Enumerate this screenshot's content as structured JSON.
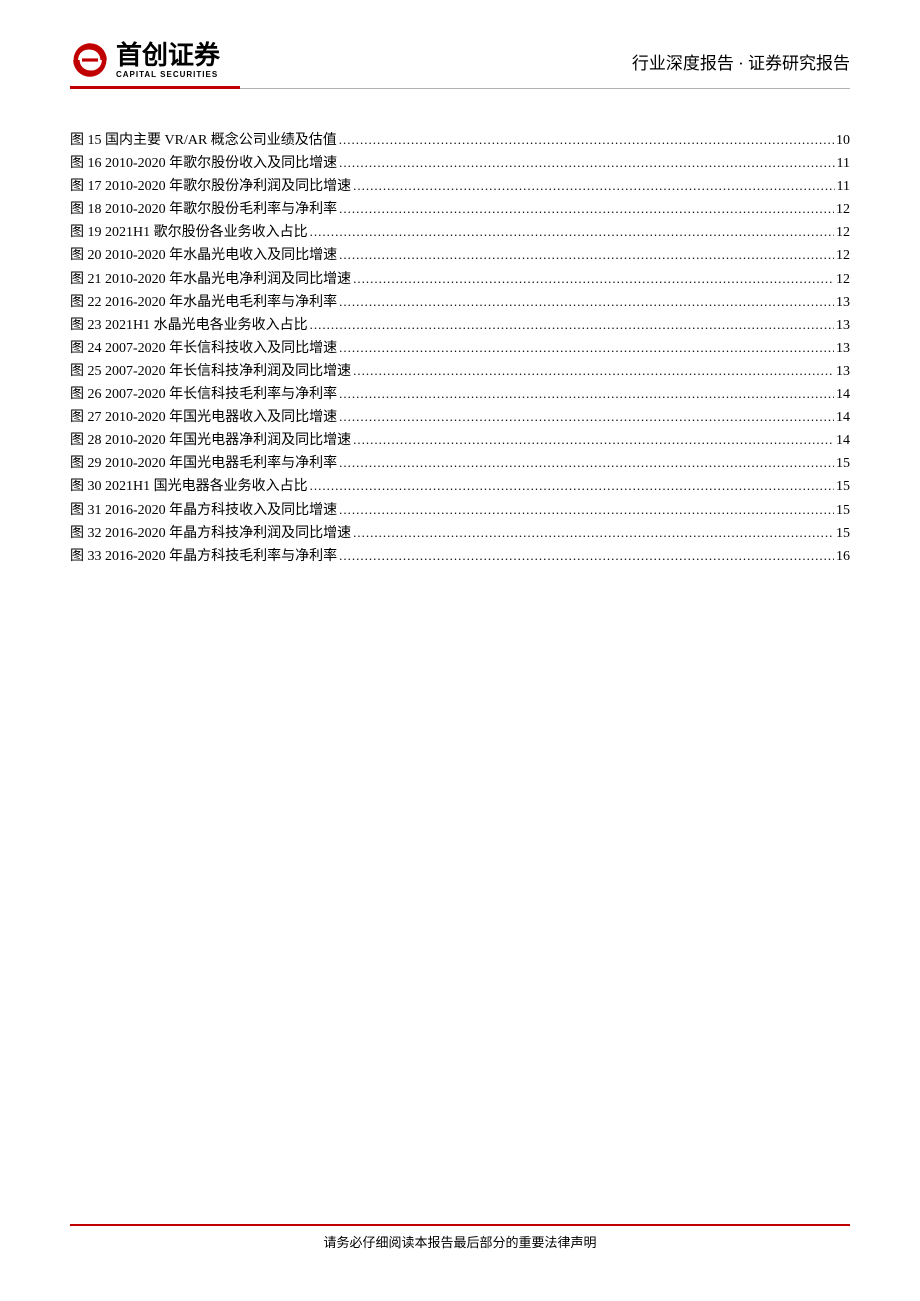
{
  "header": {
    "logo_cn": "首创证券",
    "logo_en": "CAPITAL SECURITIES",
    "right_text": "行业深度报告 · 证券研究报告"
  },
  "toc": [
    {
      "label": "图 15 国内主要 VR/AR 概念公司业绩及估值",
      "page": "10"
    },
    {
      "label": "图 16 2010-2020 年歌尔股份收入及同比增速",
      "page": "11"
    },
    {
      "label": "图 17 2010-2020 年歌尔股份净利润及同比增速",
      "page": "11"
    },
    {
      "label": "图 18 2010-2020 年歌尔股份毛利率与净利率",
      "page": "12"
    },
    {
      "label": "图 19 2021H1 歌尔股份各业务收入占比",
      "page": "12"
    },
    {
      "label": "图 20 2010-2020 年水晶光电收入及同比增速",
      "page": "12"
    },
    {
      "label": "图 21 2010-2020 年水晶光电净利润及同比增速",
      "page": "12"
    },
    {
      "label": "图 22 2016-2020 年水晶光电毛利率与净利率",
      "page": "13"
    },
    {
      "label": "图 23 2021H1 水晶光电各业务收入占比",
      "page": "13"
    },
    {
      "label": "图 24 2007-2020 年长信科技收入及同比增速",
      "page": "13"
    },
    {
      "label": "图 25 2007-2020 年长信科技净利润及同比增速",
      "page": "13"
    },
    {
      "label": "图 26 2007-2020 年长信科技毛利率与净利率",
      "page": "14"
    },
    {
      "label": "图 27 2010-2020 年国光电器收入及同比增速",
      "page": "14"
    },
    {
      "label": "图 28 2010-2020 年国光电器净利润及同比增速",
      "page": "14"
    },
    {
      "label": "图 29 2010-2020 年国光电器毛利率与净利率",
      "page": "15"
    },
    {
      "label": "图 30 2021H1 国光电器各业务收入占比",
      "page": "15"
    },
    {
      "label": "图 31 2016-2020 年晶方科技收入及同比增速",
      "page": "15"
    },
    {
      "label": "图 32 2016-2020 年晶方科技净利润及同比增速",
      "page": "15"
    },
    {
      "label": "图 33 2016-2020 年晶方科技毛利率与净利率",
      "page": "16"
    }
  ],
  "footer": {
    "text": "请务必仔细阅读本报告最后部分的重要法律声明"
  }
}
